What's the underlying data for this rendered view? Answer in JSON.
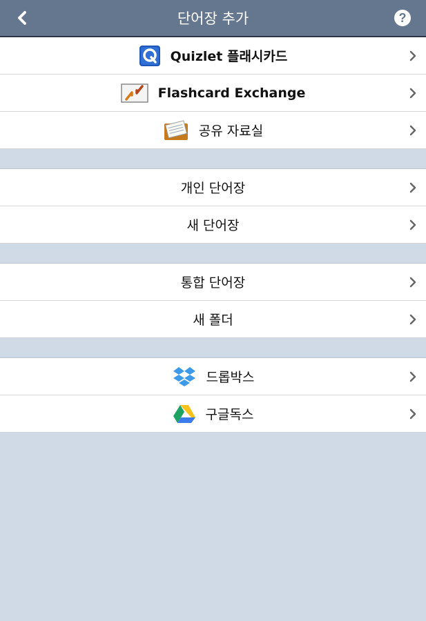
{
  "header": {
    "title": "단어장 추가",
    "back_icon": "chevron-left-icon",
    "help_icon": "question-circle-icon"
  },
  "sections": [
    {
      "items": [
        {
          "label": "Quizlet 플래시카드",
          "icon": "quizlet-icon"
        },
        {
          "label": "Flashcard Exchange",
          "icon": "flashcard-exchange-icon"
        },
        {
          "label": "공유 자료실",
          "icon": "shared-library-icon"
        }
      ]
    },
    {
      "items": [
        {
          "label": "개인 단어장"
        },
        {
          "label": "새 단어장"
        }
      ]
    },
    {
      "items": [
        {
          "label": "통합 단어장"
        },
        {
          "label": "새 폴더"
        }
      ]
    },
    {
      "items": [
        {
          "label": "드롭박스",
          "icon": "dropbox-icon"
        },
        {
          "label": "구글독스",
          "icon": "google-drive-icon"
        }
      ]
    }
  ],
  "colors": {
    "header_bg": "#65768f",
    "page_bg": "#d0d9e6",
    "row_bg": "#ffffff"
  }
}
